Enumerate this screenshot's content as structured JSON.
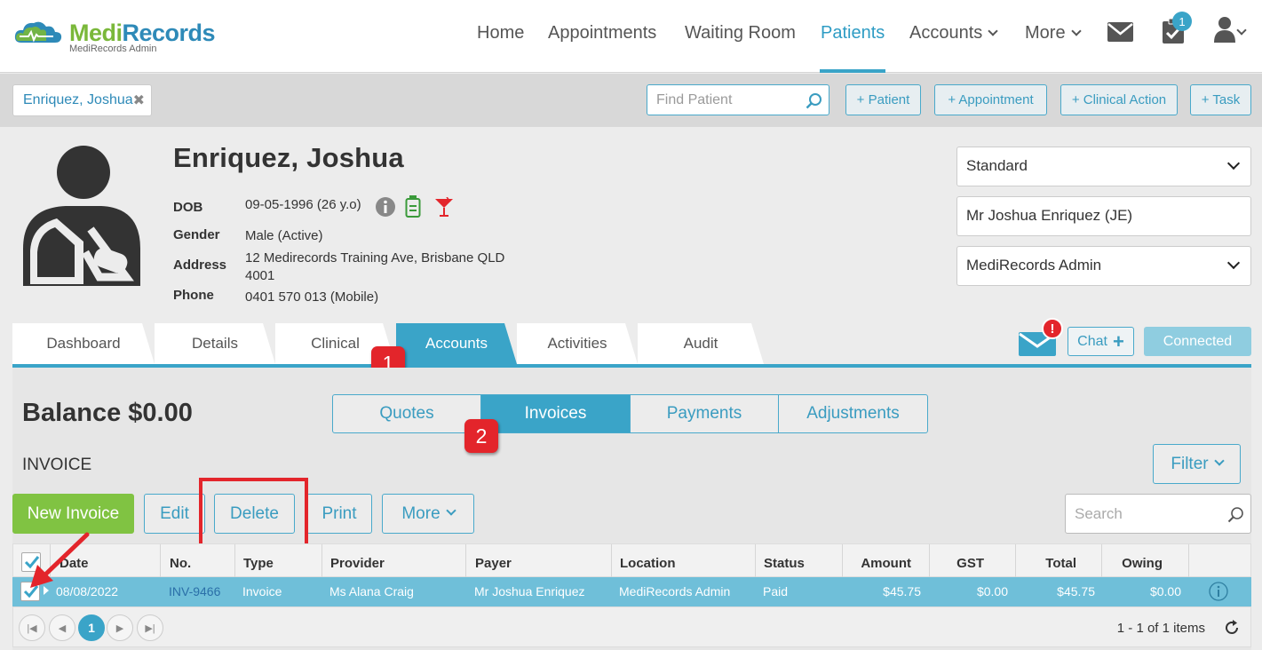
{
  "app": {
    "logo_text_a": "Medi",
    "logo_text_b": "Records",
    "logo_subtitle": "MediRecords Admin"
  },
  "nav": {
    "items": [
      "Home",
      "Appointments",
      "Waiting Room",
      "Patients",
      "Accounts",
      "More"
    ],
    "active": "Patients",
    "task_count": "1"
  },
  "toolbar": {
    "patient_tab": "Enriquez, Joshua",
    "find_placeholder": "Find Patient",
    "add_patient": "+ Patient",
    "add_appointment": "+ Appointment",
    "add_clinical_action": "+ Clinical Action",
    "add_task": "+ Task"
  },
  "patient": {
    "name": "Enriquez, Joshua",
    "dob_label": "DOB",
    "dob": "09-05-1996 (26 y.o)",
    "gender_label": "Gender",
    "gender": "Male (Active)",
    "address_label": "Address",
    "address_line1": "12 Medirecords Training Ave, Brisbane QLD",
    "address_line2": "4001",
    "phone_label": "Phone",
    "phone": "0401 570 013 (Mobile)"
  },
  "selects": {
    "fee_type": "Standard",
    "payer": "Mr Joshua Enriquez (JE)",
    "location": "MediRecords Admin"
  },
  "tabs": [
    "Dashboard",
    "Details",
    "Clinical",
    "Accounts",
    "Activities",
    "Audit"
  ],
  "active_tab": "Accounts",
  "chat": {
    "label": "Chat",
    "connected": "Connected",
    "alert": "!"
  },
  "annotations": {
    "step1": "1",
    "step2": "2"
  },
  "accounts": {
    "balance": "Balance $0.00",
    "segments": [
      "Quotes",
      "Invoices",
      "Payments",
      "Adjustments"
    ],
    "active_segment": "Invoices",
    "section_title": "INVOICE",
    "filter": "Filter",
    "buttons": {
      "new_invoice": "New Invoice",
      "edit": "Edit",
      "delete": "Delete",
      "print": "Print",
      "more": "More"
    },
    "search_placeholder": "Search"
  },
  "table": {
    "columns": [
      "Date",
      "No.",
      "Type",
      "Provider",
      "Payer",
      "Location",
      "Status",
      "Amount",
      "GST",
      "Total",
      "Owing"
    ],
    "rows": [
      {
        "date": "08/08/2022",
        "no": "INV-9466",
        "type": "Invoice",
        "provider": "Ms Alana Craig",
        "payer": "Mr Joshua Enriquez",
        "location": "MediRecords Admin",
        "status": "Paid",
        "amount": "$45.75",
        "gst": "$0.00",
        "total": "$45.75",
        "owing": "$0.00"
      }
    ]
  },
  "pager": {
    "current": "1",
    "info": "1 - 1 of 1 items"
  },
  "colors": {
    "accent": "#3aa4c8",
    "green": "#80c342",
    "highlight": "#e3252b"
  }
}
